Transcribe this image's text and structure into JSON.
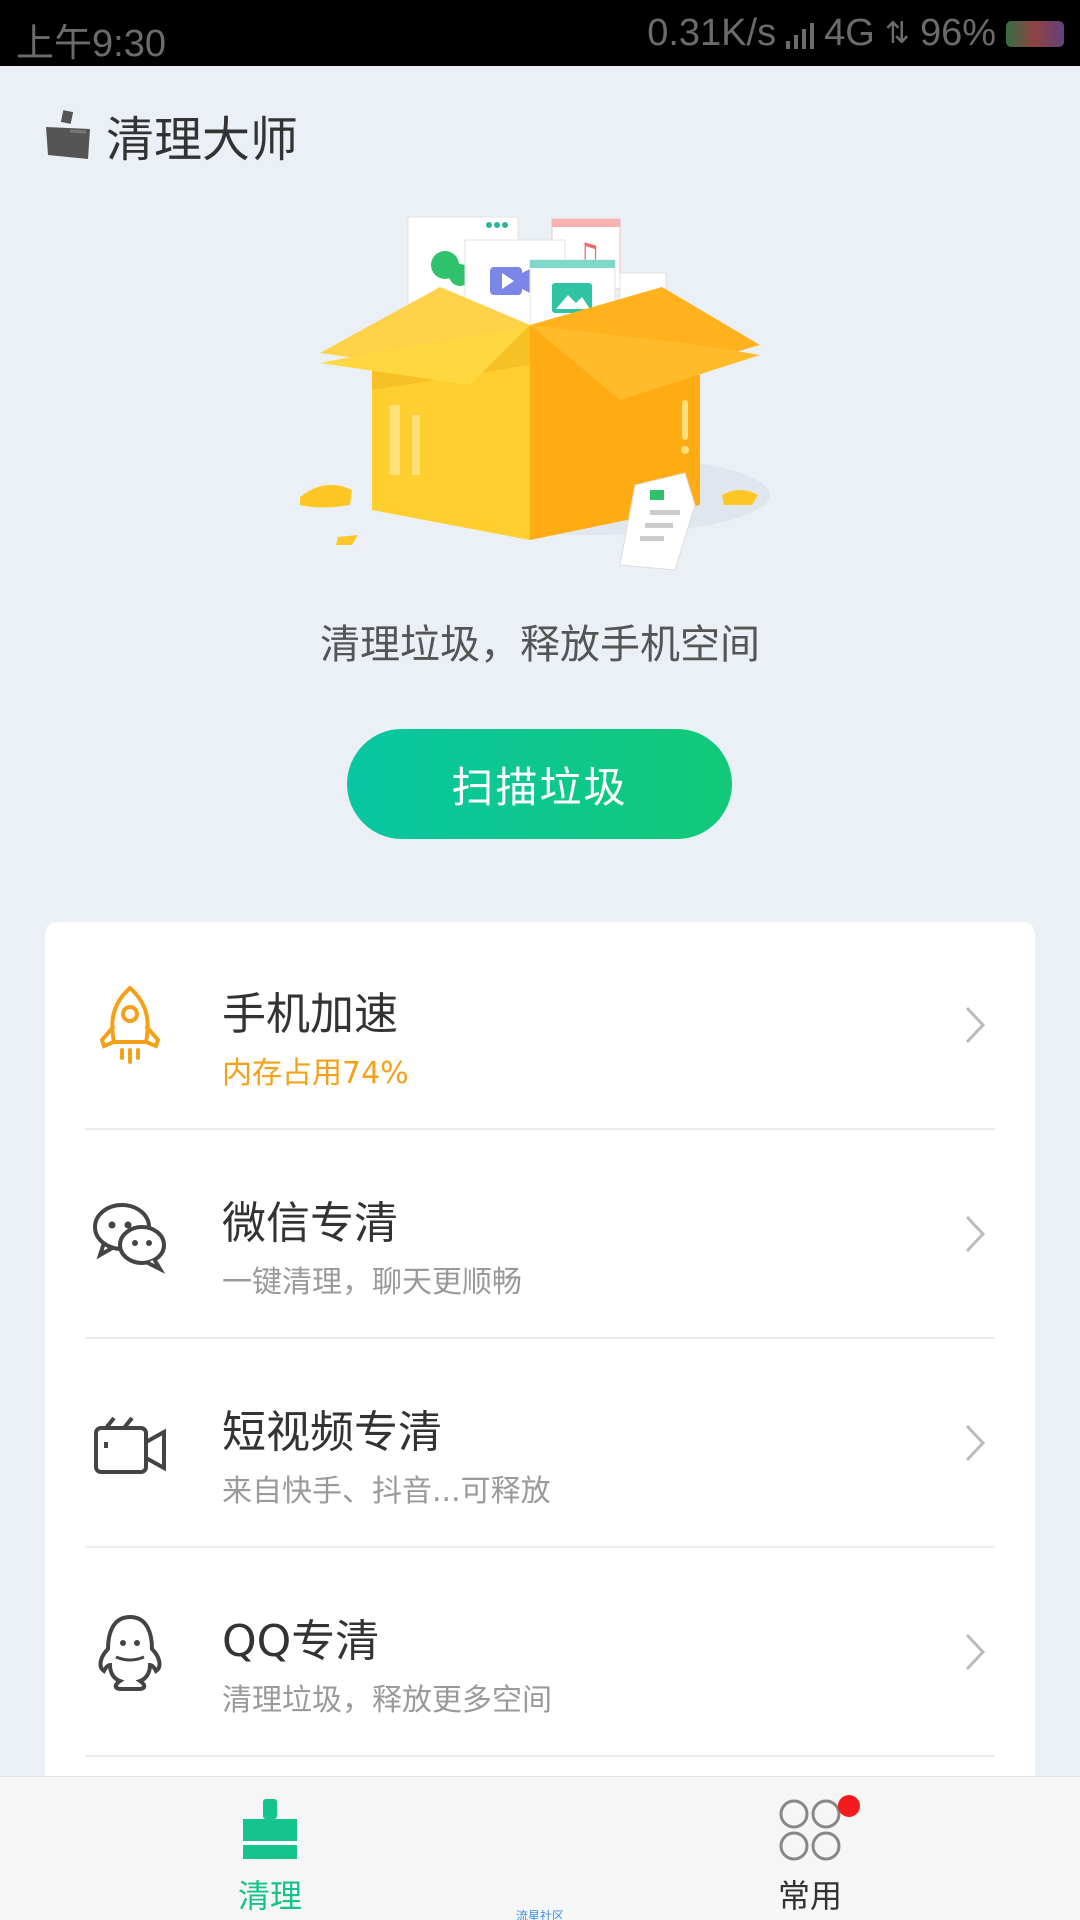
{
  "status_bar": {
    "time": "上午9:30",
    "speed": "0.31K/s",
    "network": "4G",
    "battery": "96%"
  },
  "header": {
    "title": "清理大师",
    "logo_icon": "broom-icon"
  },
  "hero": {
    "illustration": "open-box-with-files",
    "tagline": "清理垃圾，释放手机空间",
    "scan_button": "扫描垃圾"
  },
  "features": [
    {
      "title": "手机加速",
      "subtitle": "内存占用74%",
      "icon": "rocket-icon",
      "subtitle_color": "#f5a118"
    },
    {
      "title": "微信专清",
      "subtitle": "一键清理，聊天更顺畅",
      "icon": "wechat-icon"
    },
    {
      "title": "短视频专清",
      "subtitle": "来自快手、抖音...可释放",
      "icon": "video-camera-icon"
    },
    {
      "title": "QQ专清",
      "subtitle": "清理垃圾，释放更多空间",
      "icon": "qq-penguin-icon"
    }
  ],
  "bottom_nav": {
    "tabs": [
      {
        "label": "清理",
        "icon": "broom-icon",
        "active": true
      },
      {
        "label": "常用",
        "icon": "grid-circles-icon",
        "active": false,
        "badge": true
      }
    ]
  },
  "watermark": "流星社区",
  "colors": {
    "accent": "#14c48c",
    "warning": "#f5a118",
    "background": "#eaf0f6"
  }
}
